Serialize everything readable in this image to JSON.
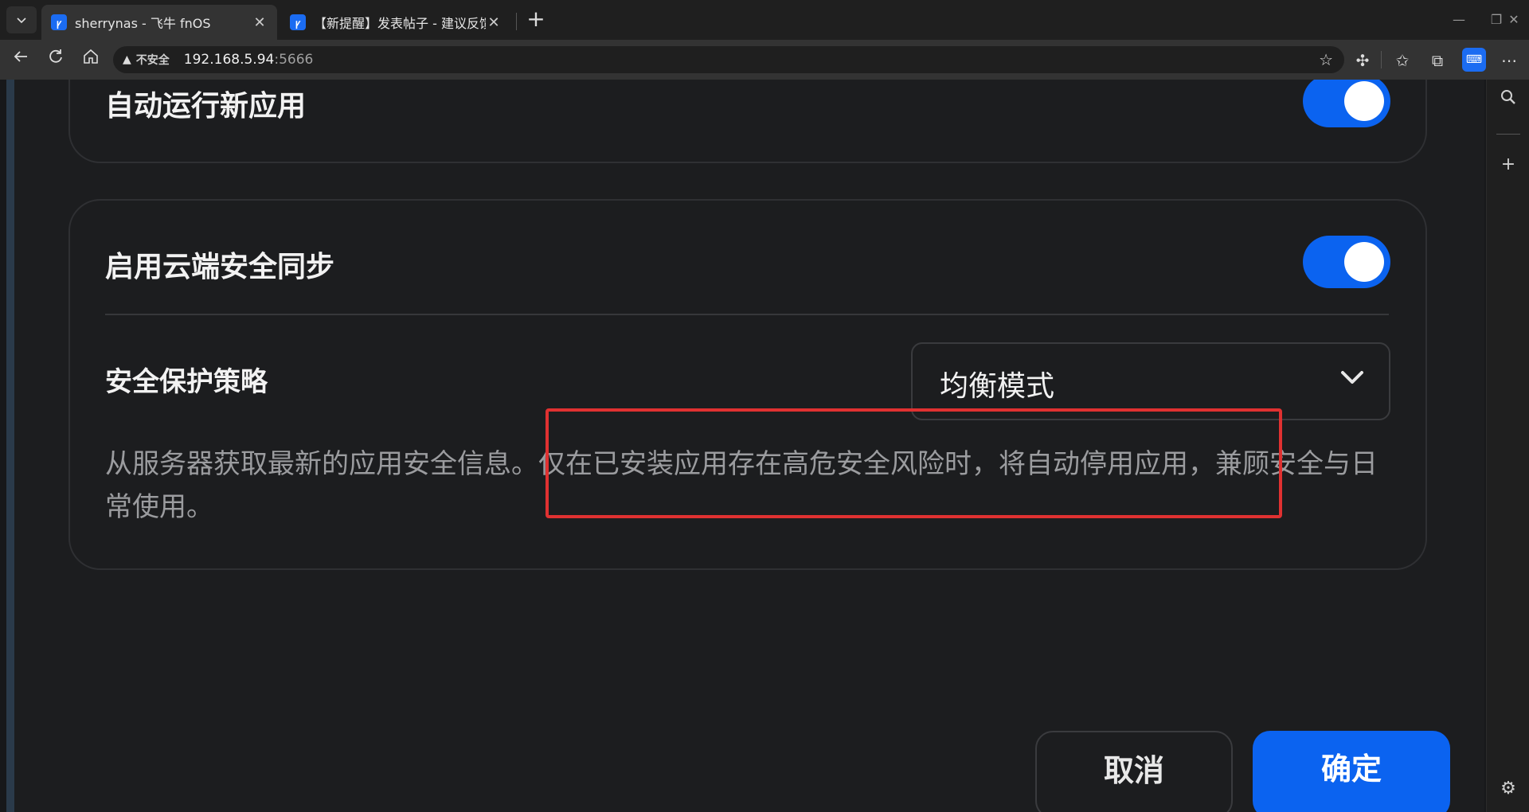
{
  "browser": {
    "tabs": [
      {
        "title": "sherrynas - 飞牛 fnOS",
        "active": true
      },
      {
        "title": "【新提醒】发表帖子 - 建议反馈 飞",
        "active": false
      }
    ],
    "tab_close_glyph": "✕",
    "new_tab_glyph": "+",
    "window_controls": [
      "—",
      "❐",
      "✕"
    ],
    "address": {
      "security_label": "不安全",
      "host": "192.168.5.94",
      "port": ":5666"
    }
  },
  "settings": {
    "auto_run": {
      "label": "自动运行新应用",
      "enabled": true
    },
    "cloud_sync": {
      "label": "启用云端安全同步",
      "enabled": true
    },
    "policy": {
      "label": "安全保护策略",
      "selected": "均衡模式"
    },
    "description": "从服务器获取最新的应用安全信息。仅在已安装应用存在高危安全风险时，将自动停用应用，兼顾安全与日常使用。"
  },
  "actions": {
    "cancel_label": "取消",
    "confirm_label": "确定"
  },
  "colors": {
    "accent": "#0b63f0",
    "highlight": "#e03131"
  }
}
